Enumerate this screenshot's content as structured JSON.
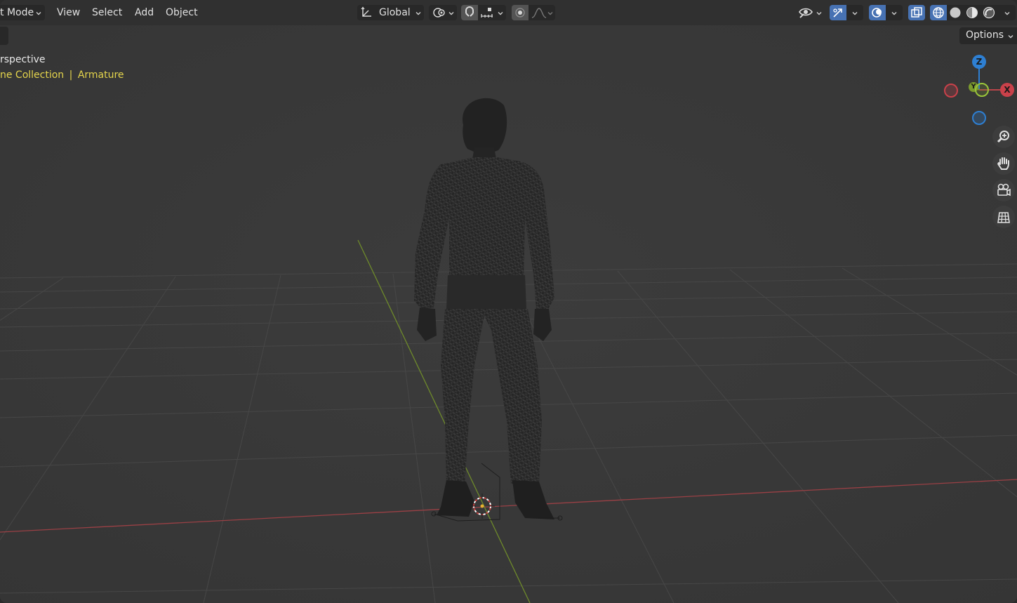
{
  "header": {
    "mode_label": "t Mode",
    "menus": [
      "View",
      "Select",
      "Add",
      "Object"
    ],
    "orientation_label": "Global"
  },
  "viewport": {
    "view_label": "rspective",
    "collection_label": "ne Collection",
    "separator": "|",
    "object_label": "Armature",
    "options_label": "Options"
  },
  "gizmo": {
    "z": "Z",
    "y": "Y",
    "x": "X"
  },
  "icons": {
    "orientation": "transform-orientation-icon",
    "pivot": "pivot-point-icon",
    "snap": "snap-magnet-icon",
    "snap_increment": "snap-increment-icon",
    "proportional": "proportional-editing-icon",
    "falloff": "falloff-curve-icon",
    "visibility": "visibility-eye-icon",
    "gizmo_toggle": "gizmo-toggle-icon",
    "overlays": "overlays-icon",
    "xray": "xray-toggle-icon",
    "shading_wireframe": "wireframe-shading-icon",
    "shading_solid": "solid-shading-icon",
    "shading_material": "material-preview-icon",
    "shading_rendered": "rendered-shading-icon",
    "zoom": "zoom-icon",
    "pan": "hand-pan-icon",
    "camera": "camera-view-icon",
    "ortho": "orthographic-grid-icon"
  },
  "colors": {
    "header_bg": "#303030",
    "viewport_bg": "#393939",
    "grid": "#4a4a4a",
    "x_axis": "#b8454a",
    "y_axis": "#7c9b2d",
    "z_axis": "#2e7fd2",
    "active_blue": "#4772b3",
    "highlight_yellow": "#e4d44c"
  }
}
